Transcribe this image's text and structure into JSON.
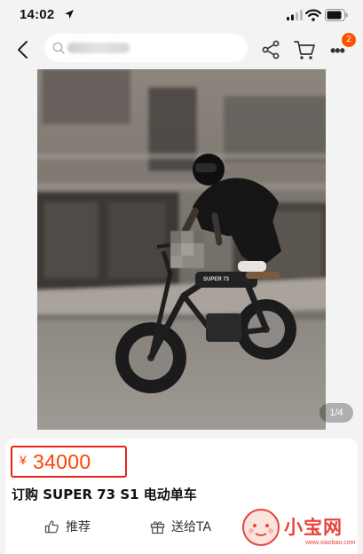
{
  "status_bar": {
    "time": "14:02"
  },
  "nav": {
    "badge_count": "2"
  },
  "gallery": {
    "counter": "1/4",
    "frame_label": "SUPER 73"
  },
  "product": {
    "price_symbol": "¥",
    "price": "34000",
    "title": "订购 SUPER 73 S1 电动单车"
  },
  "actions": [
    {
      "label": "推荐",
      "icon": "thumbs-up-icon"
    },
    {
      "label": "送给TA",
      "icon": "gift-icon"
    }
  ],
  "watermark": {
    "brand": "小宝网",
    "url": "www.xiaobao.com"
  },
  "colors": {
    "accent": "#ff4400",
    "highlight_box": "#e8231a",
    "badge": "#ff5000"
  }
}
